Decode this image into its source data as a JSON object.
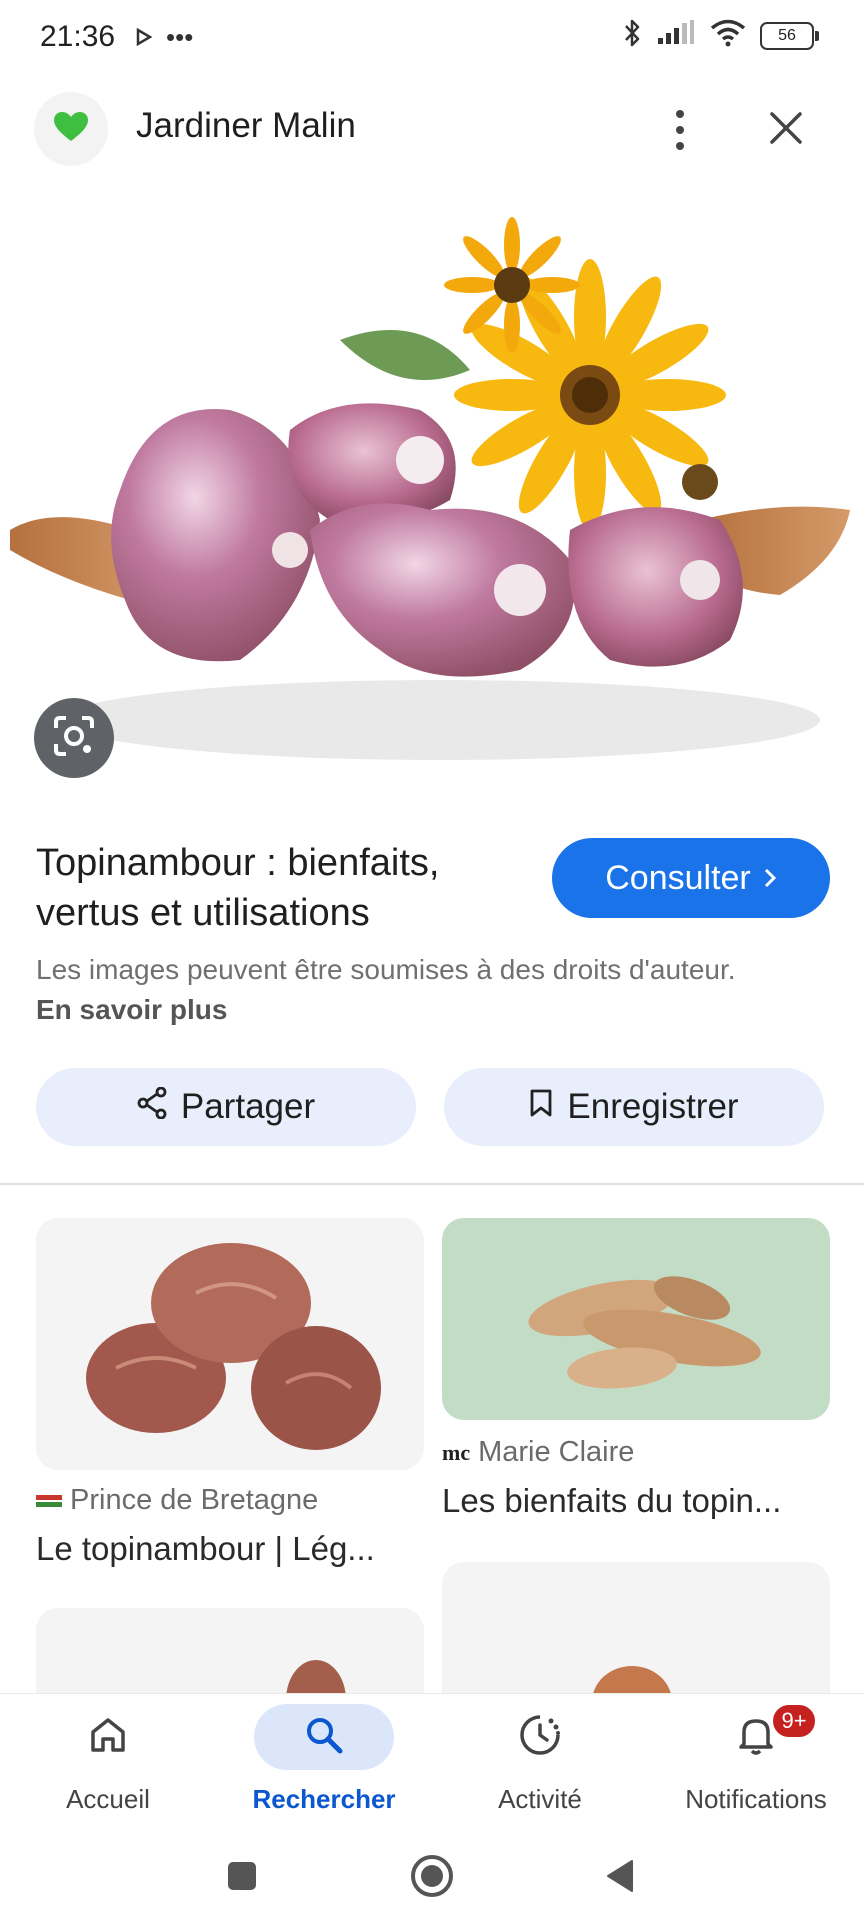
{
  "status_bar": {
    "time": "21:36",
    "battery": "56",
    "icons": [
      "play-icon",
      "more-dots-icon",
      "bluetooth-icon",
      "signal-icon",
      "wifi-icon",
      "battery-icon"
    ]
  },
  "header": {
    "title": "Jardiner Malin",
    "logo": "green-heart-icon"
  },
  "result": {
    "title": "Topinambour : bienfaits, vertus et utilisations",
    "consult_label": "Consulter",
    "rights_text": "Les images peuvent être soumises à des droits d'auteur.",
    "learn_more": "En savoir plus"
  },
  "actions": {
    "share_label": "Partager",
    "save_label": "Enregistrer"
  },
  "related": [
    {
      "source": "Prince de Bretagne",
      "title": "Le topinambour | Lég..."
    },
    {
      "source": "Marie Claire",
      "source_logo": "mc",
      "title": "Les bienfaits du topin..."
    }
  ],
  "bottom_nav": {
    "items": [
      {
        "label": "Accueil",
        "icon": "home-icon"
      },
      {
        "label": "Rechercher",
        "icon": "search-icon",
        "active": true
      },
      {
        "label": "Activité",
        "icon": "activity-icon"
      },
      {
        "label": "Notifications",
        "icon": "bell-icon",
        "badge": "9+"
      }
    ]
  },
  "colors": {
    "accent": "#1a73e8",
    "chip_bg": "#e8eefb",
    "active_nav": "#dce6fb",
    "badge": "#c5221f"
  }
}
